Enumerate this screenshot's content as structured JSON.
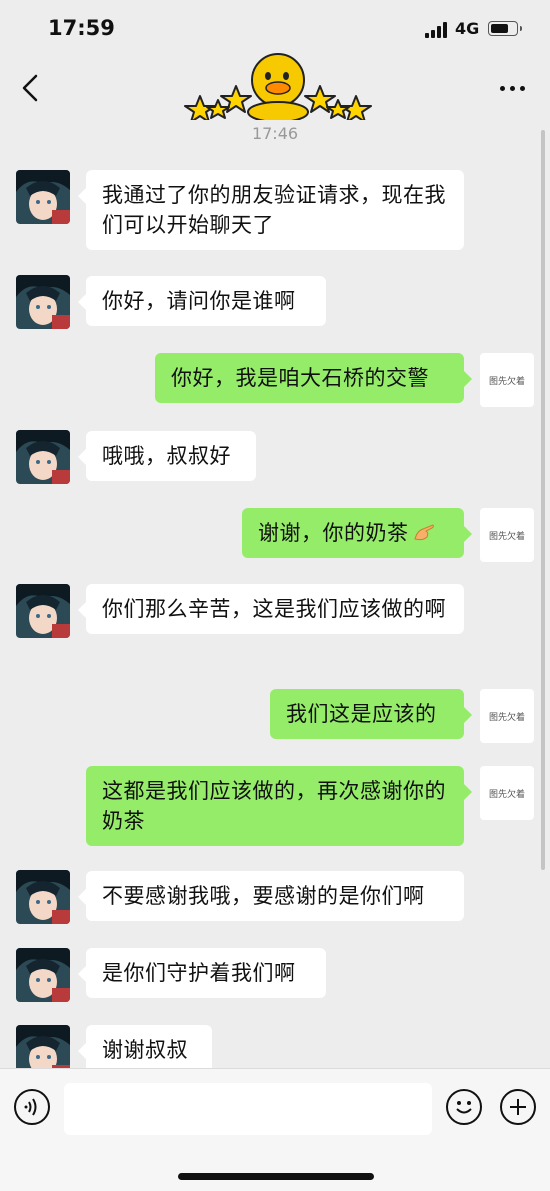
{
  "status_bar": {
    "time": "17:59",
    "network": "4G"
  },
  "chat": {
    "timestamp": "17:46",
    "my_avatar_text": "图先欠着",
    "messages": [
      {
        "from": "other",
        "text": "我通过了你的朋友验证请求，现在我们可以开始聊天了"
      },
      {
        "from": "other",
        "text": "你好，请问你是谁啊"
      },
      {
        "from": "me",
        "text": "你好，我是咱大石桥的交警"
      },
      {
        "from": "other",
        "text": "哦哦，叔叔好"
      },
      {
        "from": "me",
        "text": "谢谢，你的奶茶",
        "emoji": "pointing-hand-emoji"
      },
      {
        "from": "other",
        "text": "你们那么辛苦，这是我们应该做的啊"
      },
      {
        "from": "me",
        "text": "我们这是应该的"
      },
      {
        "from": "me",
        "text": "这都是我们应该做的，再次感谢你的奶茶"
      },
      {
        "from": "other",
        "text": "不要感谢我哦，要感谢的是你们啊"
      },
      {
        "from": "other",
        "text": "是你们守护着我们啊"
      },
      {
        "from": "other",
        "text": "谢谢叔叔"
      }
    ]
  },
  "input": {
    "value": ""
  },
  "colors": {
    "my_bubble": "#95ec69",
    "other_bubble": "#ffffff",
    "background": "#ededed"
  }
}
